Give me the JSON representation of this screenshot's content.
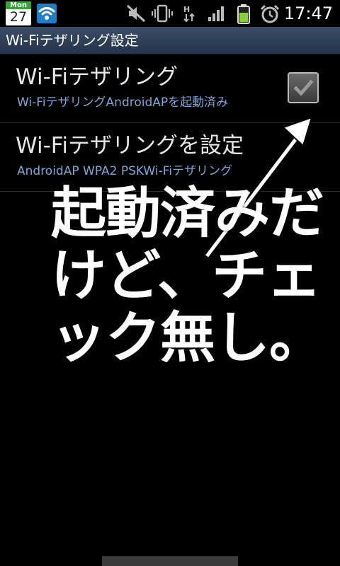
{
  "status_bar": {
    "calendar_weekday": "Mon",
    "calendar_day": "27",
    "time": "17:47",
    "icons": [
      "calendar-icon",
      "wifi-tether-icon",
      "mute-icon",
      "vibrate-icon",
      "hspa-data-icon",
      "signal-icon",
      "battery-icon",
      "alarm-icon"
    ]
  },
  "title_bar": {
    "title": "Wi-Fiテザリング設定"
  },
  "settings": {
    "items": [
      {
        "title": "Wi-Fiテザリング",
        "summary": "Wi-FiテザリングAndroidAPを起動済み",
        "checked": true
      },
      {
        "title": "Wi-Fiテザリングを設定",
        "summary": "AndroidAP WPA2 PSKWi-Fiテザリング"
      }
    ]
  },
  "annotation": {
    "text": "起動済みだけど、チェック無し。"
  },
  "colors": {
    "title_bar": "#2c3b52",
    "summary_text": "#7aa7da",
    "background": "#000000",
    "calendar_green": "#3aa23a",
    "wifi_blue": "#1e7fc9",
    "battery_green": "#8ad03a"
  }
}
